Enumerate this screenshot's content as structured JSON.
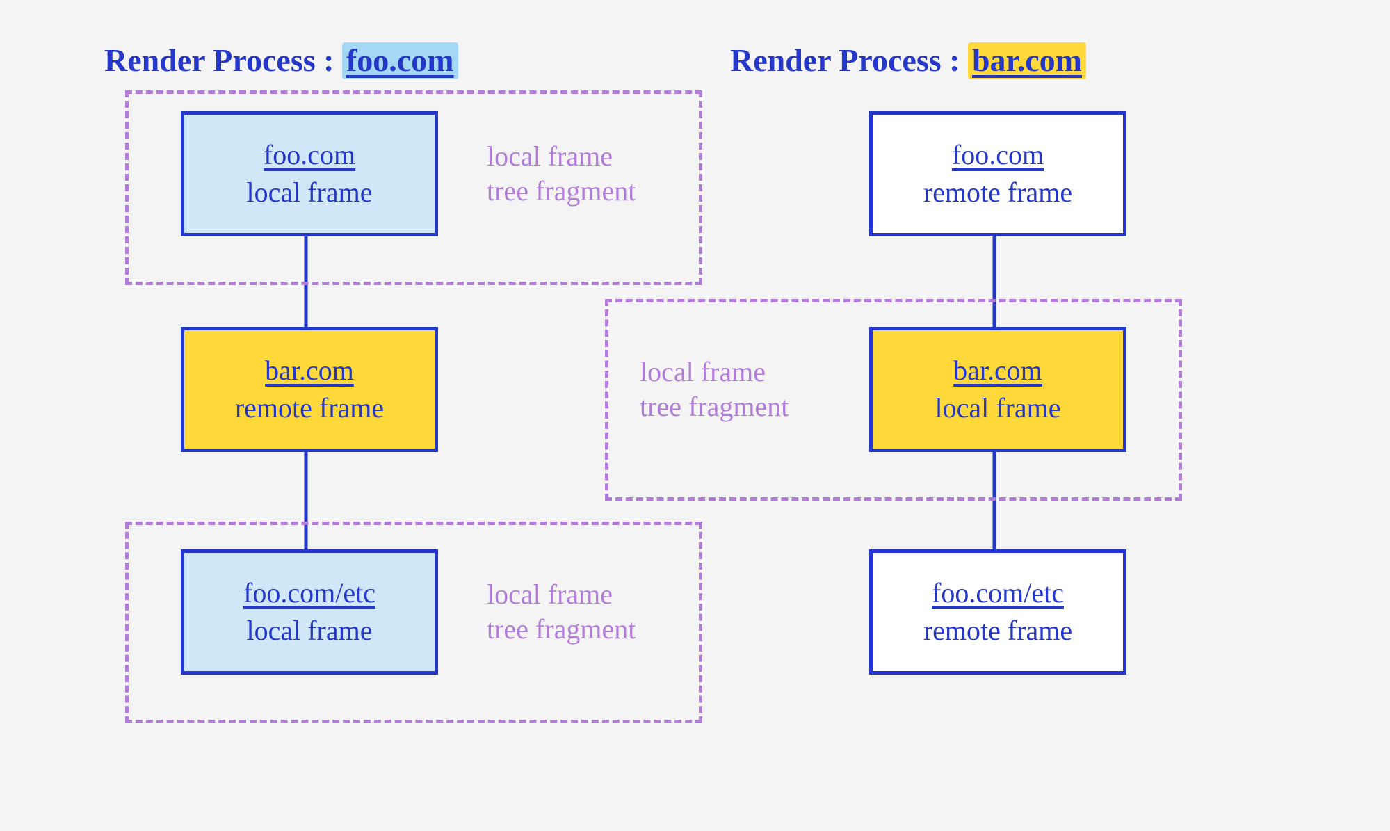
{
  "left": {
    "header_prefix": "Render Process : ",
    "header_site": "foo.com",
    "frames": [
      {
        "url": "foo.com",
        "type": "local frame"
      },
      {
        "url": "bar.com",
        "type": "remote frame"
      },
      {
        "url": "foo.com/etc",
        "type": "local frame"
      }
    ],
    "annotations": [
      "local frame\ntree fragment",
      "local frame\ntree fragment"
    ]
  },
  "right": {
    "header_prefix": "Render Process : ",
    "header_site": "bar.com",
    "frames": [
      {
        "url": "foo.com",
        "type": "remote frame"
      },
      {
        "url": "bar.com",
        "type": "local frame"
      },
      {
        "url": "foo.com/etc",
        "type": "remote frame"
      }
    ],
    "annotation": "local frame\ntree fragment"
  },
  "colors": {
    "ink": "#2437c9",
    "dash": "#b27dd8",
    "blue_fill": "#cfe7f7",
    "yellow_fill": "#ffd93a"
  }
}
